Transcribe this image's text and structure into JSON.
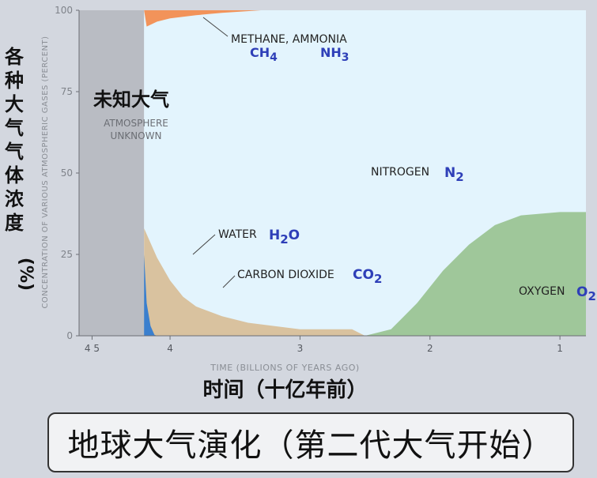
{
  "slide": {
    "background": "#d3d7df",
    "caption": "地球大气演化（第二代大气开始）"
  },
  "chart_data": {
    "type": "area",
    "x_scale": "reversed",
    "xlabel": "TIME (BILLIONS OF YEARS AGO)",
    "xlabel_cn": "时间（十亿年前）",
    "ylabel": "CONCENTRATION OF VARIOUS ATMOSPHERIC GASES (PERCENT)",
    "ylabel_cn": "各种大气气体浓度(%)",
    "xlim": [
      4.7,
      0.8
    ],
    "ylim": [
      0,
      100
    ],
    "x_ticks": [
      {
        "value": 4.6,
        "label": "4 5"
      },
      {
        "value": 4,
        "label": "4"
      },
      {
        "value": 3,
        "label": "3"
      },
      {
        "value": 2,
        "label": "2"
      },
      {
        "value": 1,
        "label": "1"
      }
    ],
    "y_ticks": [
      {
        "value": 0,
        "label": "0"
      },
      {
        "value": 25,
        "label": "25"
      },
      {
        "value": 50,
        "label": "50"
      },
      {
        "value": 75,
        "label": "75"
      },
      {
        "value": 100,
        "label": "100"
      }
    ],
    "unknown_region": {
      "x_start": 4.7,
      "x_end": 4.2,
      "label": "ATMOSPHERE UNKNOWN",
      "label_cn": "未知大气",
      "color": "#b9bcc3"
    },
    "series": [
      {
        "name": "WATER",
        "formula": "H2O",
        "color": "#3a7fce",
        "points": [
          [
            4.2,
            25
          ],
          [
            4.18,
            10
          ],
          [
            4.15,
            3
          ],
          [
            4.12,
            0.3
          ],
          [
            4.1,
            0
          ]
        ]
      },
      {
        "name": "CARBON DIOXIDE",
        "formula": "CO2",
        "color": "#d9c29f",
        "points": [
          [
            4.2,
            33
          ],
          [
            4.1,
            24
          ],
          [
            4.0,
            17
          ],
          [
            3.9,
            12
          ],
          [
            3.8,
            9
          ],
          [
            3.6,
            6
          ],
          [
            3.4,
            4
          ],
          [
            3.2,
            3
          ],
          [
            3.0,
            2
          ],
          [
            2.6,
            2
          ],
          [
            2.5,
            0
          ]
        ]
      },
      {
        "name": "OXYGEN",
        "formula": "O2",
        "color": "#9fc79a",
        "points": [
          [
            2.5,
            0
          ],
          [
            2.3,
            2
          ],
          [
            2.1,
            10
          ],
          [
            1.9,
            20
          ],
          [
            1.7,
            28
          ],
          [
            1.5,
            34
          ],
          [
            1.3,
            37
          ],
          [
            1.0,
            38
          ],
          [
            0.8,
            38
          ]
        ]
      },
      {
        "name": "METHANE, AMMONIA",
        "formulas": [
          "CH4",
          "NH3"
        ],
        "color": "#f2935a",
        "points": [
          [
            4.2,
            100
          ],
          [
            4.18,
            95
          ],
          [
            4.1,
            96.5
          ],
          [
            4.0,
            97.5
          ],
          [
            3.8,
            98.5
          ],
          [
            3.6,
            99.2
          ],
          [
            3.3,
            100
          ]
        ]
      },
      {
        "name": "NITROGEN",
        "formula": "N2",
        "color": "#e3f4fd",
        "fills_remainder": true
      }
    ]
  }
}
